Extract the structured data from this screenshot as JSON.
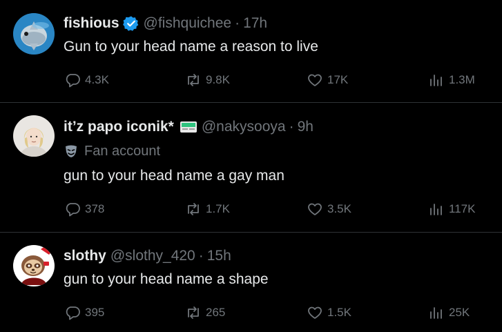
{
  "tweets": [
    {
      "name": "fishious",
      "handle": "@fishquichee",
      "dot": "·",
      "time": "17h",
      "text": "Gun to your head name a reason to live",
      "replies": "4.3K",
      "reposts": "9.8K",
      "likes": "17K",
      "views": "1.3M",
      "avatar_icon": "sunfish-avatar",
      "verified_color": "#1d9bf0"
    },
    {
      "name": "it’z papo iconik*",
      "handle": "@nakysooya",
      "dot": "·",
      "time": "9h",
      "fan_label": "Fan account",
      "text": "gun to your head name a gay man",
      "replies": "378",
      "reposts": "1.7K",
      "likes": "3.5K",
      "views": "117K",
      "avatar_icon": "blonde-person-avatar"
    },
    {
      "name": "slothy",
      "handle": "@slothy_420",
      "dot": "·",
      "time": "15h",
      "text": "gun to your head name a shape",
      "replies": "395",
      "reposts": "265",
      "likes": "1.5K",
      "views": "25K",
      "avatar_icon": "cartoon-sloth-avatar"
    }
  ],
  "colors": {
    "background": "#000000",
    "primary_text": "#e7e9ea",
    "secondary_text": "#71767b",
    "divider": "#2f3336"
  }
}
